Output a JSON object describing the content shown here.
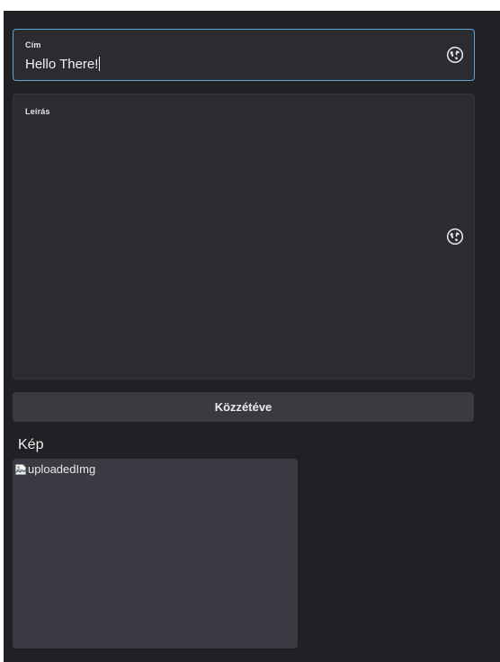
{
  "title_field": {
    "label": "Cím",
    "value": "Hello There!"
  },
  "description_field": {
    "label": "Leírás",
    "value": ""
  },
  "publish_button": {
    "label": "Közzétéve"
  },
  "image_section": {
    "title": "Kép",
    "alt": "uploadedImg"
  },
  "icons": {
    "translate": "globe-icon",
    "broken_image": "broken-image-icon"
  },
  "colors": {
    "background": "#202124",
    "field": "#2b2c30",
    "focus_border": "#5aa6d6",
    "button": "#3a3b41",
    "image_placeholder": "#3a3a42"
  }
}
